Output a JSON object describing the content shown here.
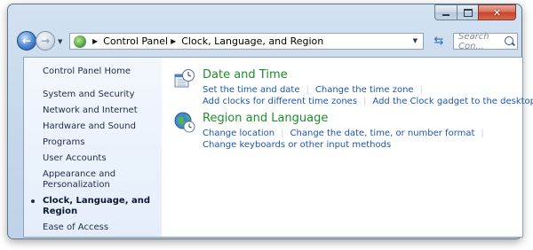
{
  "window": {
    "caption_buttons": {
      "minimize_icon": "minimize-icon",
      "maximize_icon": "maximize-icon",
      "close_icon": "close-icon"
    }
  },
  "toolbar": {
    "back_icon": "back-arrow-icon",
    "forward_icon": "forward-arrow-icon",
    "breadcrumb": [
      "Control Panel",
      "Clock, Language, and Region"
    ],
    "search_placeholder": "Search Con..."
  },
  "sidebar": {
    "home": "Control Panel Home",
    "items": [
      {
        "label": "System and Security",
        "active": false
      },
      {
        "label": "Network and Internet",
        "active": false
      },
      {
        "label": "Hardware and Sound",
        "active": false
      },
      {
        "label": "Programs",
        "active": false
      },
      {
        "label": "User Accounts",
        "active": false
      },
      {
        "label": "Appearance and Personalization",
        "active": false
      },
      {
        "label": "Clock, Language, and Region",
        "active": true
      },
      {
        "label": "Ease of Access",
        "active": false
      }
    ]
  },
  "categories": [
    {
      "title": "Date and Time",
      "icon": "clock-calendar-icon",
      "links_row1": [
        "Set the time and date",
        "Change the time zone"
      ],
      "links_row2": [
        "Add clocks for different time zones",
        "Add the Clock gadget to the desktop"
      ]
    },
    {
      "title": "Region and Language",
      "icon": "globe-clock-icon",
      "links_row1": [
        "Change location",
        "Change the date, time, or number format"
      ],
      "links_row2": [
        "Change keyboards or other input methods"
      ]
    }
  ],
  "colors": {
    "category_title": "#1f8d2a",
    "link": "#1c57b0",
    "sidebar_text": "#1e2d48"
  }
}
